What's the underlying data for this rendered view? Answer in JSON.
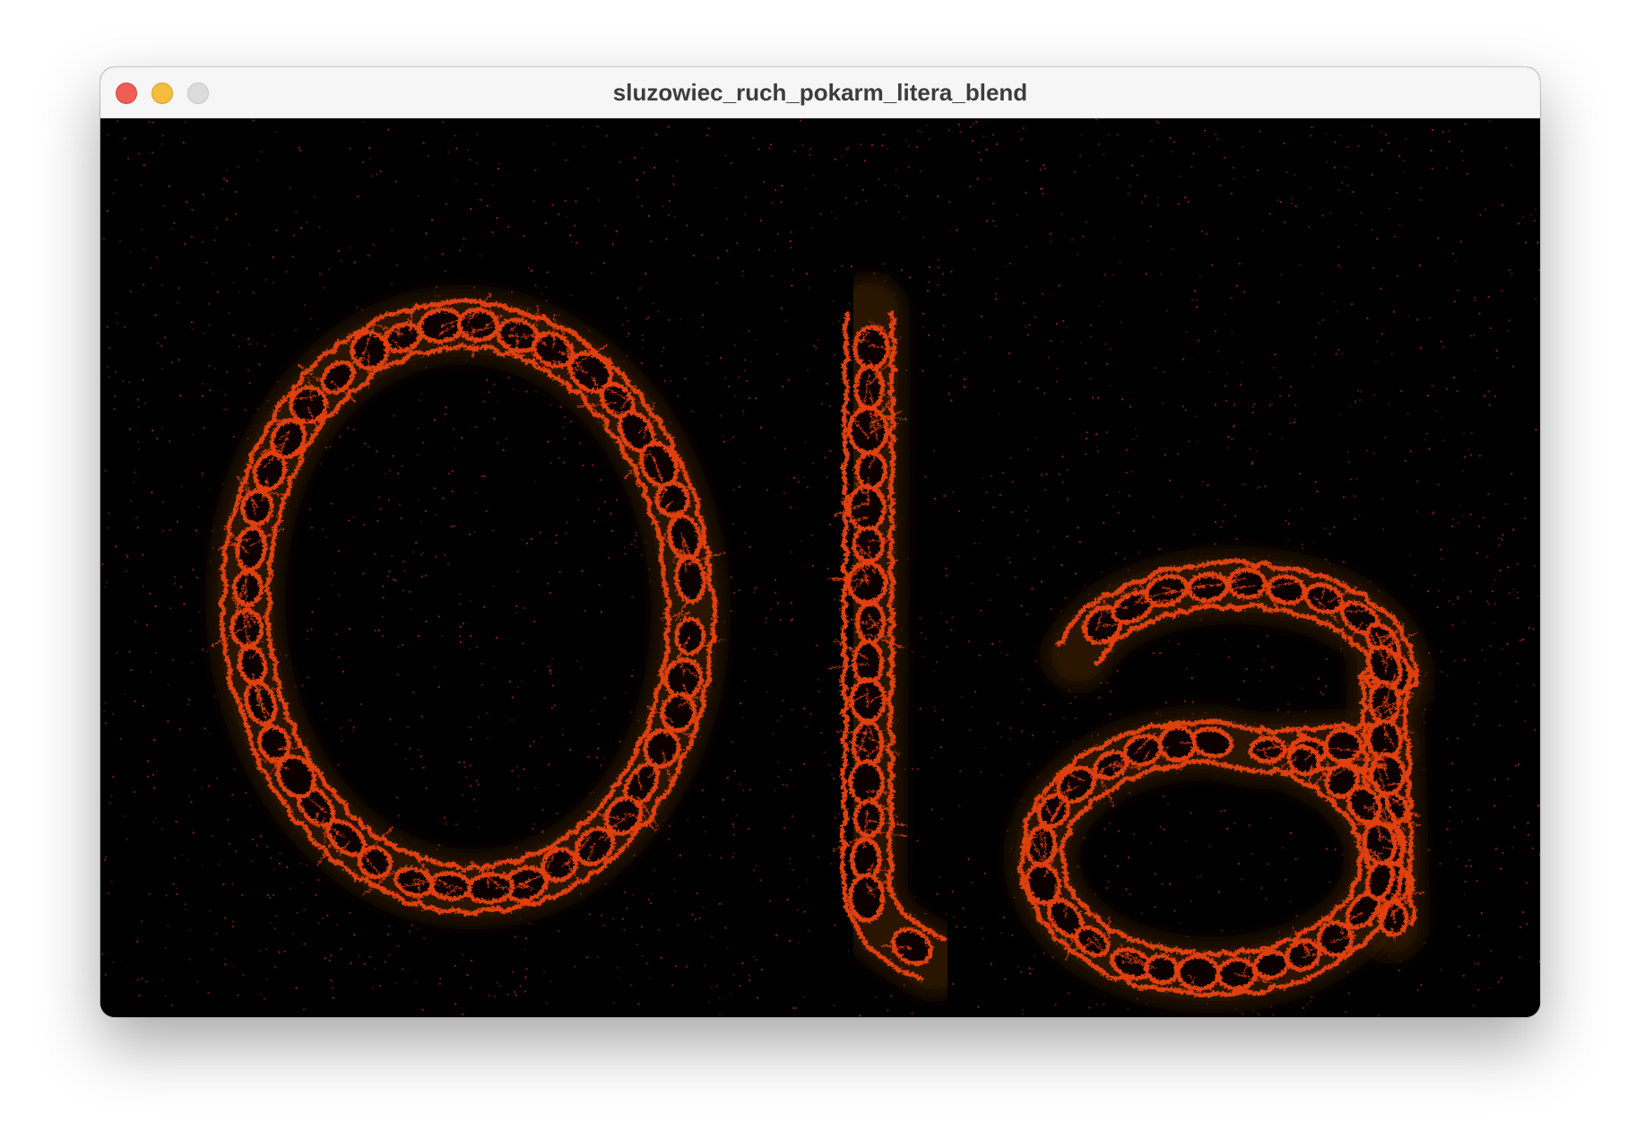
{
  "window": {
    "title": "sluzowiec_ruch_pokarm_litera_blend",
    "controls": [
      "close-icon",
      "minimize-icon",
      "zoom-icon"
    ]
  },
  "canvas": {
    "text": "Ola",
    "background_color": "#000000",
    "slime_color": "#e0400a",
    "glow_color": "#2a1200",
    "particle_color": "#c0330a"
  }
}
